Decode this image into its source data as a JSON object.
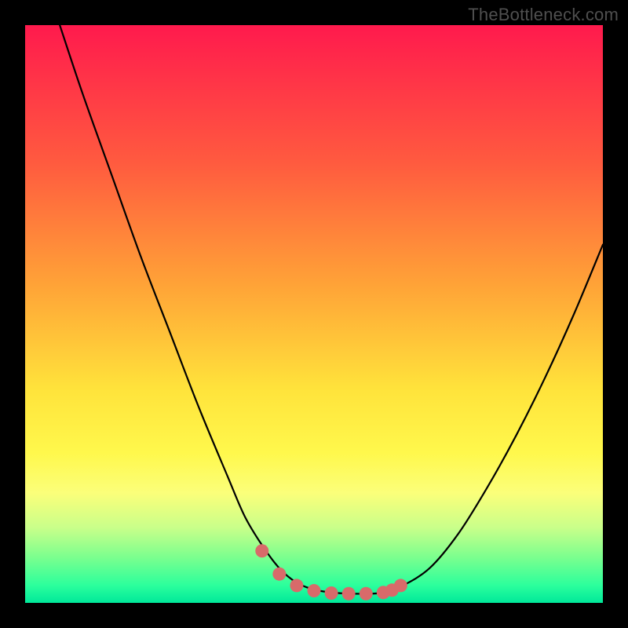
{
  "watermark": "TheBottleneck.com",
  "colors": {
    "frame": "#000000",
    "curve": "#000000",
    "marker_fill": "#d86a6a",
    "marker_stroke": "#c95858"
  },
  "chart_data": {
    "type": "line",
    "title": "",
    "xlabel": "",
    "ylabel": "",
    "xlim": [
      0,
      100
    ],
    "ylim": [
      0,
      100
    ],
    "grid": false,
    "legend": false,
    "series": [
      {
        "name": "bottleneck-curve",
        "x": [
          6,
          10,
          15,
          20,
          25,
          30,
          35,
          38,
          41,
          44,
          47,
          50,
          53,
          56,
          60,
          62,
          65,
          70,
          75,
          80,
          85,
          90,
          95,
          100
        ],
        "values": [
          100,
          88,
          74,
          60,
          47,
          34,
          22,
          15,
          10,
          6,
          3.5,
          2.3,
          1.8,
          1.6,
          1.6,
          1.8,
          2.8,
          6,
          12,
          20,
          29,
          39,
          50,
          62
        ]
      }
    ],
    "markers": {
      "name": "bottleneck-markers",
      "x": [
        41,
        44,
        47,
        50,
        53,
        56,
        59,
        62,
        63.5,
        65
      ],
      "values": [
        9,
        5,
        3,
        2.1,
        1.7,
        1.6,
        1.6,
        1.8,
        2.2,
        3
      ]
    },
    "gradient_stops": [
      {
        "pos": 0.0,
        "color": "#ff1a4d"
      },
      {
        "pos": 0.24,
        "color": "#ff5b3f"
      },
      {
        "pos": 0.45,
        "color": "#ffa337"
      },
      {
        "pos": 0.63,
        "color": "#ffe33b"
      },
      {
        "pos": 0.74,
        "color": "#fff84c"
      },
      {
        "pos": 0.81,
        "color": "#fbff7a"
      },
      {
        "pos": 0.87,
        "color": "#c9ff8a"
      },
      {
        "pos": 0.92,
        "color": "#7dff8e"
      },
      {
        "pos": 0.97,
        "color": "#2bff9c"
      },
      {
        "pos": 1.0,
        "color": "#00e89a"
      }
    ]
  }
}
